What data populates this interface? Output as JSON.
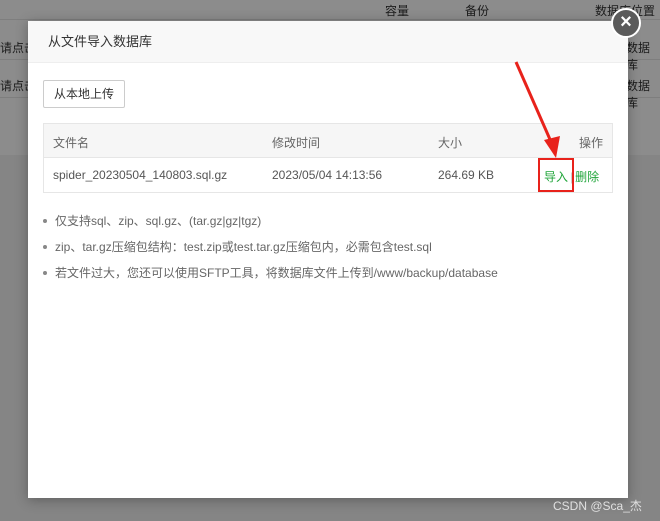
{
  "background": {
    "columns": [
      "容量",
      "备份",
      "数据库位置"
    ],
    "row_left_text": "请点击",
    "row_right_text": "数据库",
    "rows": 2
  },
  "modal": {
    "title": "从文件导入数据库",
    "close_label": "×",
    "upload_label": "从本地上传",
    "table": {
      "headers": [
        "文件名",
        "修改时间",
        "大小",
        "操作"
      ],
      "rows": [
        {
          "name": "spider_20230504_140803.sql.gz",
          "modified": "2023/05/04 14:13:56",
          "size": "264.69 KB",
          "import_label": "导入",
          "separator": "|",
          "delete_label": "删除"
        }
      ]
    },
    "tips": [
      "仅支持sql、zip、sql.gz、(tar.gz|gz|tgz)",
      "zip、tar.gz压缩包结构：test.zip或test.tar.gz压缩包内，必需包含test.sql",
      "若文件过大，您还可以使用SFTP工具，将数据库文件上传到/www/backup/database"
    ]
  },
  "annotation": {
    "highlight_color": "#e8221b"
  },
  "watermark": "CSDN @Sca_杰",
  "colors": {
    "accent_green": "#20a53a",
    "close_button": "#5b5b5b"
  }
}
